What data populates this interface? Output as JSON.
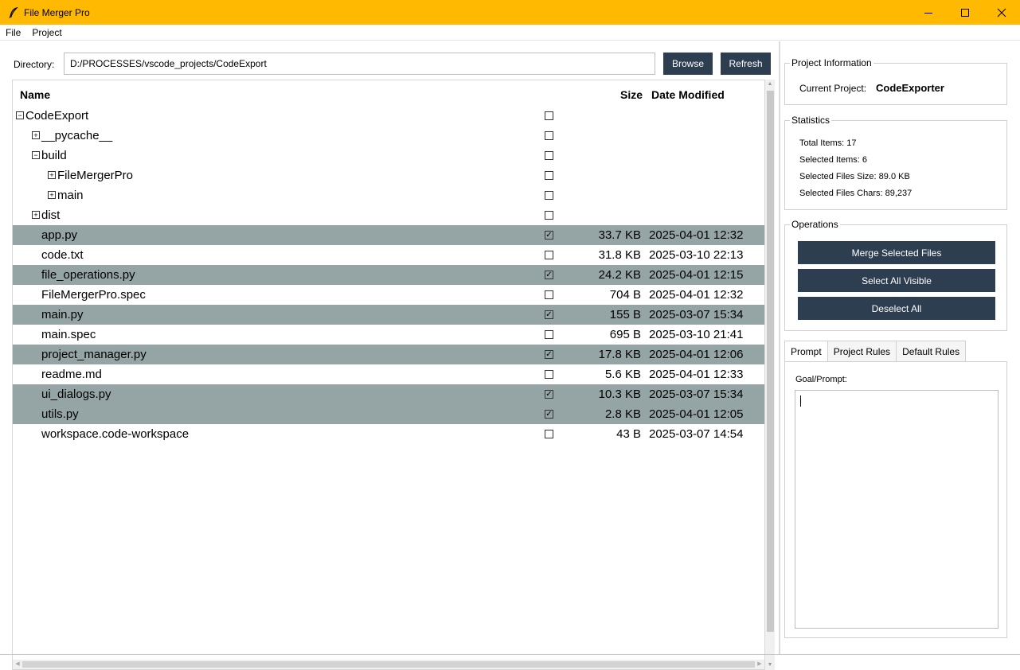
{
  "window": {
    "title": "File Merger Pro"
  },
  "menu": [
    "File",
    "Project"
  ],
  "directory": {
    "label": "Directory:",
    "value": "D:/PROCESSES/vscode_projects/CodeExport",
    "browse": "Browse",
    "refresh": "Refresh"
  },
  "tree": {
    "columns": {
      "name": "Name",
      "size": "Size",
      "date": "Date Modified"
    },
    "rows": [
      {
        "name": "CodeExport",
        "depth": 0,
        "expander": "⊟",
        "size": "",
        "date": "",
        "checked": false,
        "selected": false
      },
      {
        "name": "__pycache__",
        "depth": 1,
        "expander": "⊞",
        "size": "",
        "date": "",
        "checked": false,
        "selected": false
      },
      {
        "name": "build",
        "depth": 1,
        "expander": "⊟",
        "size": "",
        "date": "",
        "checked": false,
        "selected": false
      },
      {
        "name": "FileMergerPro",
        "depth": 2,
        "expander": "⊞",
        "size": "",
        "date": "",
        "checked": false,
        "selected": false
      },
      {
        "name": "main",
        "depth": 2,
        "expander": "⊞",
        "size": "",
        "date": "",
        "checked": false,
        "selected": false
      },
      {
        "name": "dist",
        "depth": 1,
        "expander": "⊞",
        "size": "",
        "date": "",
        "checked": false,
        "selected": false
      },
      {
        "name": "app.py",
        "depth": 1,
        "expander": "",
        "size": "33.7 KB",
        "date": "2025-04-01 12:32",
        "checked": true,
        "selected": true
      },
      {
        "name": "code.txt",
        "depth": 1,
        "expander": "",
        "size": "31.8 KB",
        "date": "2025-03-10 22:13",
        "checked": false,
        "selected": false
      },
      {
        "name": "file_operations.py",
        "depth": 1,
        "expander": "",
        "size": "24.2 KB",
        "date": "2025-04-01 12:15",
        "checked": true,
        "selected": true
      },
      {
        "name": "FileMergerPro.spec",
        "depth": 1,
        "expander": "",
        "size": "704 B",
        "date": "2025-04-01 12:32",
        "checked": false,
        "selected": false
      },
      {
        "name": "main.py",
        "depth": 1,
        "expander": "",
        "size": "155 B",
        "date": "2025-03-07 15:34",
        "checked": true,
        "selected": true
      },
      {
        "name": "main.spec",
        "depth": 1,
        "expander": "",
        "size": "695 B",
        "date": "2025-03-10 21:41",
        "checked": false,
        "selected": false
      },
      {
        "name": "project_manager.py",
        "depth": 1,
        "expander": "",
        "size": "17.8 KB",
        "date": "2025-04-01 12:06",
        "checked": true,
        "selected": true
      },
      {
        "name": "readme.md",
        "depth": 1,
        "expander": "",
        "size": "5.6 KB",
        "date": "2025-04-01 12:33",
        "checked": false,
        "selected": false
      },
      {
        "name": "ui_dialogs.py",
        "depth": 1,
        "expander": "",
        "size": "10.3 KB",
        "date": "2025-03-07 15:34",
        "checked": true,
        "selected": true
      },
      {
        "name": "utils.py",
        "depth": 1,
        "expander": "",
        "size": "2.8 KB",
        "date": "2025-04-01 12:05",
        "checked": true,
        "selected": true
      },
      {
        "name": "workspace.code-workspace",
        "depth": 1,
        "expander": "",
        "size": "43 B",
        "date": "2025-03-07 14:54",
        "checked": false,
        "selected": false
      }
    ]
  },
  "project_info": {
    "legend": "Project Information",
    "label": "Current Project:",
    "value": "CodeExporter"
  },
  "statistics": {
    "legend": "Statistics",
    "items": [
      "Total Items: 17",
      "Selected Items: 6",
      "Selected Files Size: 89.0 KB",
      "Selected Files Chars: 89,237"
    ]
  },
  "operations": {
    "legend": "Operations",
    "merge": "Merge Selected Files",
    "select_all": "Select All Visible",
    "deselect_all": "Deselect All"
  },
  "tabs": [
    "Prompt",
    "Project Rules",
    "Default Rules"
  ],
  "prompt": {
    "label": "Goal/Prompt:",
    "value": ""
  },
  "colors": {
    "titlebar": "#ffb900",
    "button": "#2c3e50",
    "selected_row": "#95a5a6"
  }
}
